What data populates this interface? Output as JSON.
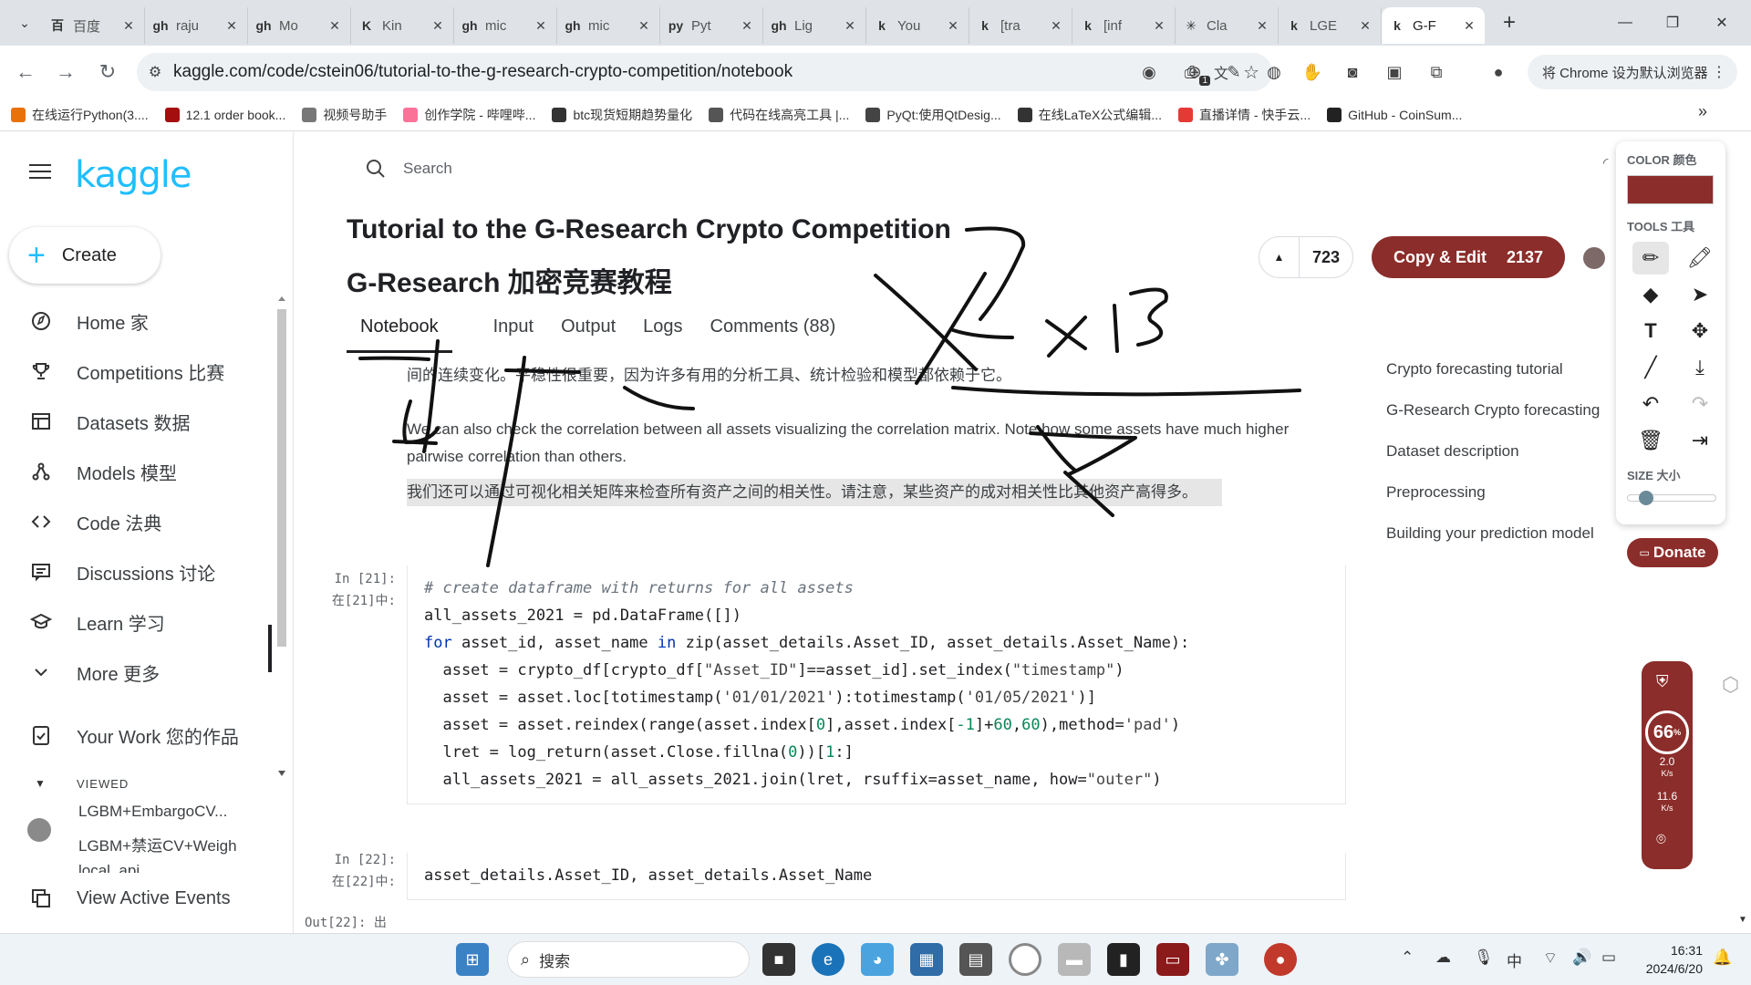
{
  "browser": {
    "tabs": [
      {
        "icon": "百",
        "label": "百度"
      },
      {
        "icon": "gh",
        "label": "raju"
      },
      {
        "icon": "gh",
        "label": "Mo"
      },
      {
        "icon": "K",
        "label": "Kin"
      },
      {
        "icon": "gh",
        "label": "mic"
      },
      {
        "icon": "gh",
        "label": "mic"
      },
      {
        "icon": "py",
        "label": "Pyt"
      },
      {
        "icon": "gh",
        "label": "Lig"
      },
      {
        "icon": "k",
        "label": "You"
      },
      {
        "icon": "k",
        "label": "[tra"
      },
      {
        "icon": "k",
        "label": "[inf"
      },
      {
        "icon": "✳",
        "label": "Cla"
      },
      {
        "icon": "k",
        "label": "LGE"
      },
      {
        "icon": "k",
        "label": "G-F"
      }
    ],
    "url": "kaggle.com/code/cstein06/tutorial-to-the-g-research-crypto-competition/notebook",
    "default_browser_prompt": "将 Chrome 设为默认浏览器",
    "extension_badge": "1",
    "bookmarks": [
      "在线运行Python(3....",
      "12.1 order book...",
      "视频号助手",
      "创作学院 - 哔哩哔...",
      "btc现货短期趋势量化",
      "代码在线高亮工具 |...",
      "PyQt:使用QtDesig...",
      "在线LaTeX公式编辑...",
      "直播详情 - 快手云...",
      "GitHub - CoinSum..."
    ]
  },
  "sidebar": {
    "logo": "kaggle",
    "create_label": "Create",
    "nav": [
      {
        "label": "Home 家",
        "icon": "home-icon"
      },
      {
        "label": "Competitions 比赛",
        "icon": "trophy-icon"
      },
      {
        "label": "Datasets 数据",
        "icon": "table-icon"
      },
      {
        "label": "Models 模型",
        "icon": "models-icon"
      },
      {
        "label": "Code 法典",
        "icon": "code-icon"
      },
      {
        "label": "Discussions 讨论",
        "icon": "discussions-icon"
      },
      {
        "label": "Learn 学习",
        "icon": "learn-icon"
      },
      {
        "label": "More 更多",
        "icon": "chevron-down-icon"
      }
    ],
    "your_work": "Your Work 您的作品",
    "viewed_title": "VIEWED",
    "viewed": [
      "LGBM+EmbargoCV...",
      "LGBM+禁运CV+Weigh",
      "local_api"
    ],
    "view_active_events": "View Active Events"
  },
  "main": {
    "search_placeholder": "Search",
    "title_en": "Tutorial to the G-Research Crypto Competition",
    "title_zh": "G-Research 加密竞赛教程",
    "votes": "723",
    "copy_edit_label": "Copy & Edit",
    "copy_edit_count": "2137",
    "tabs": [
      "Notebook",
      "Input",
      "Output",
      "Logs",
      "Comments (88)"
    ],
    "para1": "间的连续变化。平稳性很重要，因为许多有用的分析工具、统计检验和模型都依赖于它。",
    "para2": "We can also check the correlation between all assets visualizing the correlation matrix. Note how some assets have much higher pairwise correlation than others.",
    "para3": "我们还可以通过可视化相关矩阵来检查所有资产之间的相关性。请注意，某些资产的成对相关性比其他资产高得多。",
    "cell21_label_en": "In [21]:",
    "cell21_label_zh": "在[21]中:",
    "cell22_label_en": "In [22]:",
    "cell22_label_zh": "在[22]中:",
    "out22_label": "Out[22]: 出",
    "cell22_code": "asset_details.Asset_ID, asset_details.Asset_Name"
  },
  "toc": [
    "Crypto forecasting tutorial",
    "G-Research Crypto forecasting",
    "Dataset description",
    "Preprocessing",
    "Building your prediction model"
  ],
  "draw_panel": {
    "color_title": "COLOR 颜色",
    "color_value": "#8b2d2a",
    "tools_title": "TOOLS 工具",
    "size_title": "SIZE 大小",
    "size_fraction": 0.1
  },
  "donate_label": "Donate",
  "net_widget": {
    "percent": "66",
    "percent_unit": "%",
    "up_value": "2.0",
    "up_unit": "K/s",
    "down_value": "11.6",
    "down_unit": "K/s"
  },
  "ink_text": {
    "annotation1": "X4",
    "annotation2": "X13"
  },
  "taskbar": {
    "search_label": "搜索",
    "ime": "中",
    "time": "16:31",
    "date": "2024/6/20"
  }
}
